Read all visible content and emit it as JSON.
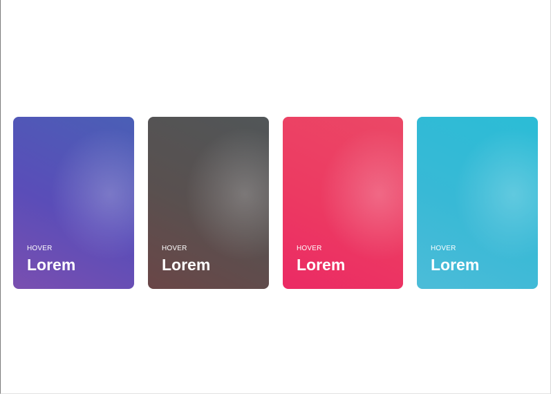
{
  "cards": [
    {
      "kicker": "HOVER",
      "title": "Lorem"
    },
    {
      "kicker": "HOVER",
      "title": "Lorem"
    },
    {
      "kicker": "HOVER",
      "title": "Lorem"
    },
    {
      "kicker": "HOVER",
      "title": "Lorem"
    }
  ],
  "colors": {
    "card_1": "#5a4db8",
    "card_2": "#59504f",
    "card_3": "#ec3a62",
    "card_4": "#38b9d6",
    "text": "#ffffff",
    "background": "#ffffff"
  }
}
